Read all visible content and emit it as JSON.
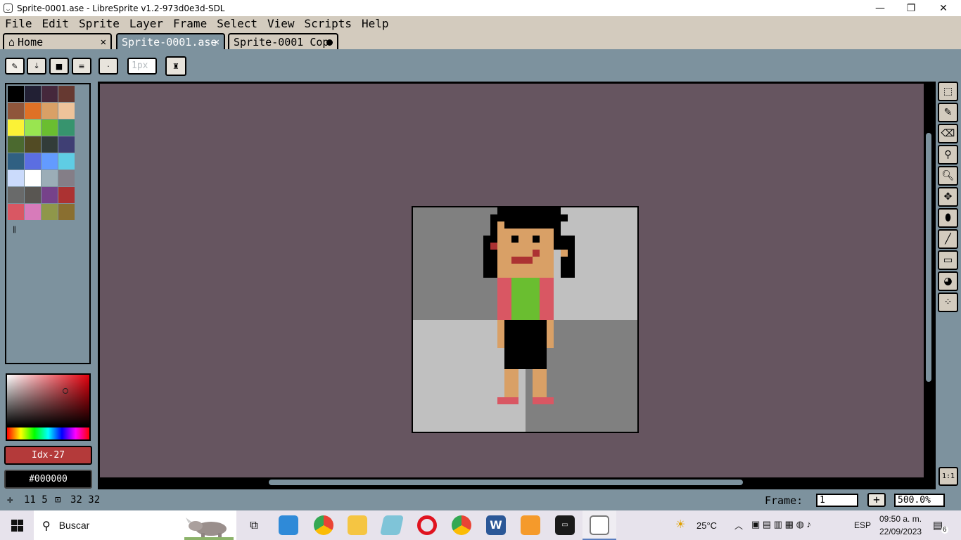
{
  "window": {
    "title": "Sprite-0001.ase - LibreSprite v1.2-973d0e3d-SDL",
    "minimize": "—",
    "maximize": "❐",
    "close": "✕"
  },
  "menu": [
    "File",
    "Edit",
    "Sprite",
    "Layer",
    "Frame",
    "Select",
    "View",
    "Scripts",
    "Help"
  ],
  "tabs": [
    {
      "label": "Home",
      "close": "✕"
    },
    {
      "label": "Sprite-0001.ase",
      "close": "✕"
    },
    {
      "label": "Sprite-0001 Cop"
    }
  ],
  "context": {
    "brush_size_placeholder": "1px"
  },
  "palette": {
    "colors": [
      "#000000",
      "#222034",
      "#45283c",
      "#663931",
      "#8f563b",
      "#df7126",
      "#d9a066",
      "#eec39a",
      "#fbf236",
      "#99e550",
      "#6abe30",
      "#37946e",
      "#4b692f",
      "#524b24",
      "#323c39",
      "#3f3f74",
      "#306082",
      "#5b6ee1",
      "#639bff",
      "#5fcde4",
      "#cbdbfc",
      "#ffffff",
      "#9badb7",
      "#847e87",
      "#696a6a",
      "#595652",
      "#76428a",
      "#ac3232",
      "#d95763",
      "#d77bba",
      "#8f974a",
      "#8a6f30"
    ]
  },
  "colors": {
    "foreground_label": "Idx-27",
    "background_label": "#000000"
  },
  "status": {
    "cursor_pos": "11 5",
    "sprite_size": "32 32",
    "frame_label": "Frame:",
    "frame_value": "1",
    "frame_add": "+",
    "zoom_value": "500.0%"
  },
  "zoom_button": "1:1",
  "taskbar": {
    "search_placeholder": "Buscar",
    "weather": "25°C",
    "language": "ESP",
    "time": "09:50 a. m.",
    "date": "22/09/2023",
    "notifications": "6"
  }
}
